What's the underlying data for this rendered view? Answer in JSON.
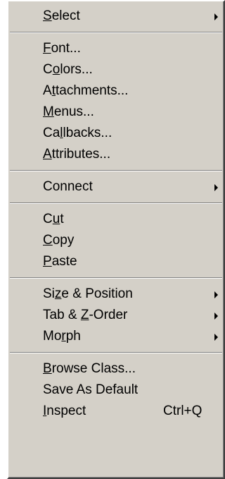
{
  "menu": {
    "groups": [
      [
        {
          "pre": "",
          "accel": "S",
          "post": "elect",
          "submenu": true
        }
      ],
      [
        {
          "pre": "",
          "accel": "F",
          "post": "ont..."
        },
        {
          "pre": "C",
          "accel": "o",
          "post": "lors..."
        },
        {
          "pre": "A",
          "accel": "t",
          "post": "tachments..."
        },
        {
          "pre": "",
          "accel": "M",
          "post": "enus..."
        },
        {
          "pre": "Ca",
          "accel": "l",
          "post": "lbacks..."
        },
        {
          "pre": "",
          "accel": "A",
          "post": "ttributes..."
        }
      ],
      [
        {
          "pre": "Connect",
          "accel": "",
          "post": "",
          "submenu": true
        }
      ],
      [
        {
          "pre": "C",
          "accel": "u",
          "post": "t"
        },
        {
          "pre": "",
          "accel": "C",
          "post": "opy"
        },
        {
          "pre": "",
          "accel": "P",
          "post": "aste"
        }
      ],
      [
        {
          "pre": "Si",
          "accel": "z",
          "post": "e & Position",
          "submenu": true
        },
        {
          "pre": "Tab & ",
          "accel": "Z",
          "post": "-Order",
          "submenu": true
        },
        {
          "pre": "Mo",
          "accel": "r",
          "post": "ph",
          "submenu": true
        }
      ],
      [
        {
          "pre": "",
          "accel": "B",
          "post": "rowse Class..."
        },
        {
          "pre": "Save As Default",
          "accel": "",
          "post": ""
        },
        {
          "pre": "",
          "accel": "I",
          "post": "nspect",
          "shortcut": "Ctrl+Q"
        }
      ]
    ]
  }
}
